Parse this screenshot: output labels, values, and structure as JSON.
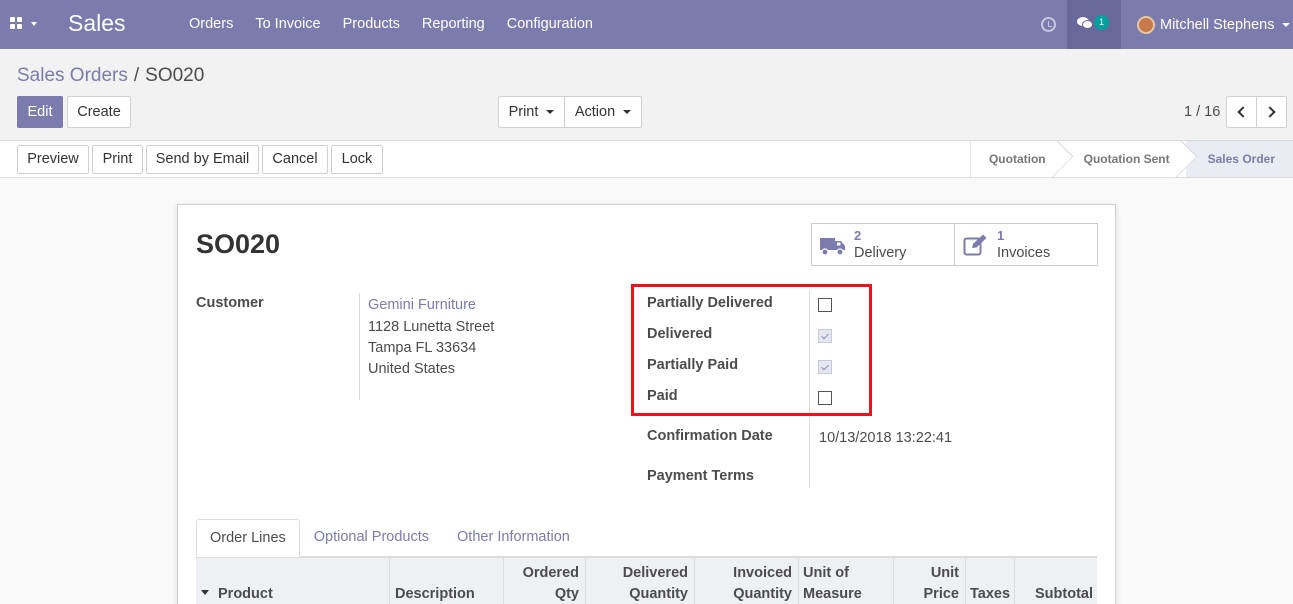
{
  "navbar": {
    "brand": "Sales",
    "menu": [
      "Orders",
      "To Invoice",
      "Products",
      "Reporting",
      "Configuration"
    ],
    "chat_count": "1",
    "user_name": "Mitchell Stephens"
  },
  "breadcrumb": {
    "parent": "Sales Orders",
    "separator": "/",
    "current": "SO020"
  },
  "toolbar": {
    "edit": "Edit",
    "create": "Create",
    "print": "Print",
    "action": "Action"
  },
  "pager": {
    "value": "1 / 16"
  },
  "status_actions": [
    "Preview",
    "Print",
    "Send by Email",
    "Cancel",
    "Lock"
  ],
  "stages": [
    "Quotation",
    "Quotation Sent",
    "Sales Order"
  ],
  "active_stage": "Sales Order",
  "record": {
    "name": "SO020",
    "smart_buttons": [
      {
        "count": "2",
        "label": "Delivery",
        "icon": "truck-icon"
      },
      {
        "count": "1",
        "label": "Invoices",
        "icon": "edit-icon"
      }
    ],
    "customer_label": "Customer",
    "customer": {
      "name": "Gemini Furniture",
      "street": "1128 Lunetta Street",
      "city": "Tampa FL 33634",
      "country": "United States"
    },
    "flags": [
      {
        "label": "Partially Delivered",
        "checked": false
      },
      {
        "label": "Delivered",
        "checked": true
      },
      {
        "label": "Partially Paid",
        "checked": true
      },
      {
        "label": "Paid",
        "checked": false
      }
    ],
    "confirmation_date_label": "Confirmation Date",
    "confirmation_date": "10/13/2018 13:22:41",
    "payment_terms_label": "Payment Terms",
    "payment_terms": ""
  },
  "tabs": [
    "Order Lines",
    "Optional Products",
    "Other Information"
  ],
  "columns": {
    "product": "Product",
    "description": "Description",
    "ordered_qty_1": "Ordered",
    "ordered_qty_2": "Qty",
    "delivered_1": "Delivered",
    "delivered_2": "Quantity",
    "invoiced_1": "Invoiced",
    "invoiced_2": "Quantity",
    "uom_1": "Unit of",
    "uom_2": "Measure",
    "price_1": "Unit",
    "price_2": "Price",
    "taxes": "Taxes",
    "subtotal": "Subtotal"
  },
  "colors": {
    "brand": "#7c7bad",
    "highlight": "#e8131b"
  }
}
